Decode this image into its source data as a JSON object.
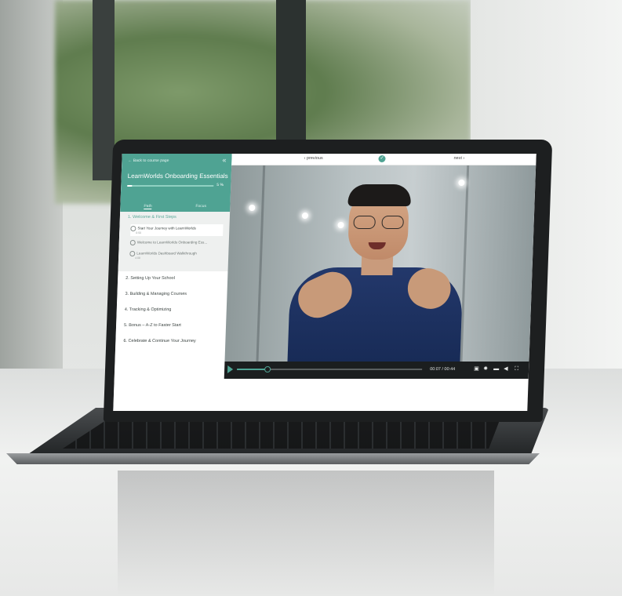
{
  "scene": {
    "description_kind": "photo of a laptop on a glossy table showing an online course video player"
  },
  "sidebar": {
    "back_link": "← Back to course page",
    "course_title": "LearnWorlds Onboarding Essentials",
    "progress_percent": 5,
    "progress_label": "5 %",
    "tabs": [
      {
        "label": "Path",
        "active": true
      },
      {
        "label": "Focus",
        "active": false
      }
    ],
    "open_section": {
      "label": "1. Welcome & First Steps",
      "lessons": [
        {
          "title": "Start Your Journey with LearnWorlds",
          "meta": "0:50",
          "current": true
        },
        {
          "title": "Welcome to LearnWorlds Onboarding Ess...",
          "meta": "",
          "current": false
        },
        {
          "title": "LearnWorlds Dashboard Walkthrough",
          "meta": "4:08",
          "current": false
        }
      ]
    },
    "sections": [
      "2. Setting Up Your School",
      "3. Building & Managing Courses",
      "4. Tracking & Optimizing",
      "5. Bonus – A-Z to Faster Start",
      "6. Celebrate & Continue Your Journey"
    ]
  },
  "topbar": {
    "previous_label": "‹ previous",
    "next_label": "next ›",
    "complete_icon": "check-icon",
    "accent": "#4fa393"
  },
  "player": {
    "current_time": "00:07",
    "duration": "00:44",
    "timecode": "00:07 / 00:44",
    "played_fraction": 0.16,
    "control_icons": [
      "subtitles-icon",
      "settings-icon",
      "speed-icon",
      "volume-icon",
      "fullscreen-icon"
    ]
  }
}
